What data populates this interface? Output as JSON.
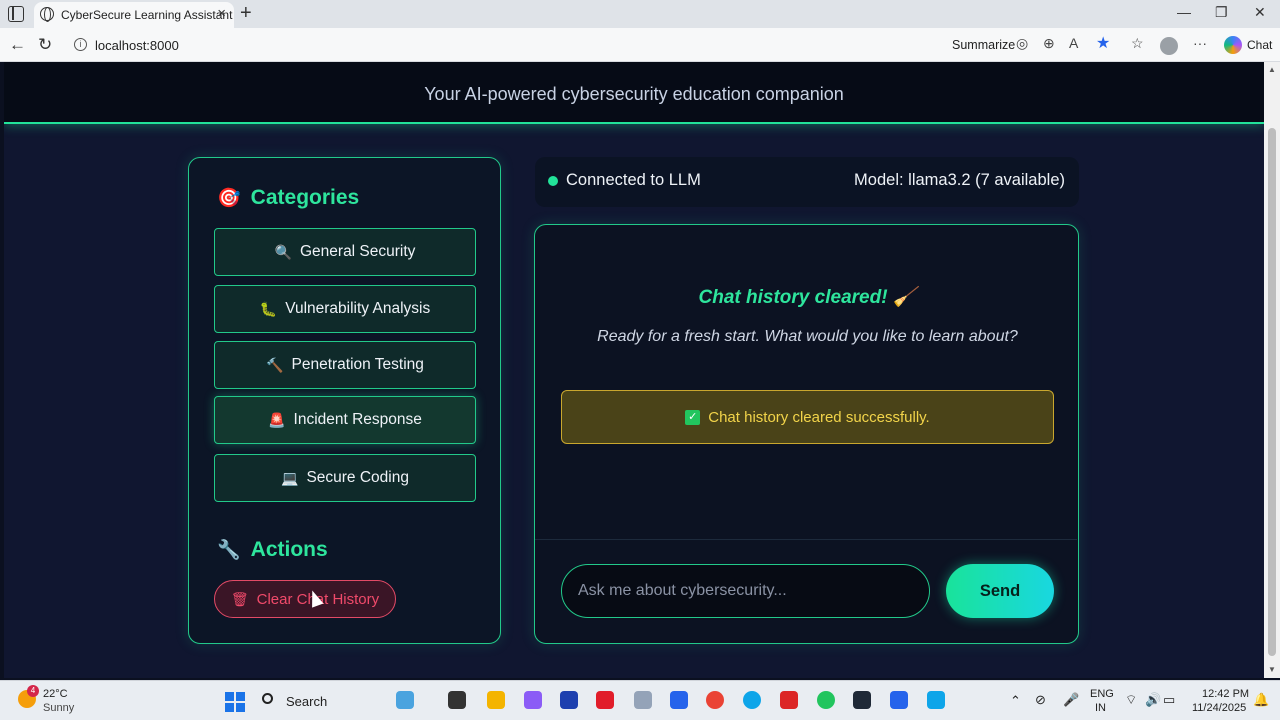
{
  "browser": {
    "tab_title": "CyberSecure Learning Assistant",
    "url": "localhost:8000",
    "summarize_label": "Summarize",
    "chat_label": "Chat"
  },
  "header": {
    "subtitle": "Your AI-powered cybersecurity education companion"
  },
  "sidebar": {
    "categories_title": "Categories",
    "categories_icon": "🎯",
    "categories": [
      {
        "icon": "🔍",
        "label": "General Security",
        "icon_name": "magnifier-icon"
      },
      {
        "icon": "🐛",
        "label": "Vulnerability Analysis",
        "icon_name": "bug-icon"
      },
      {
        "icon": "🔨",
        "label": "Penetration Testing",
        "icon_name": "hammer-icon"
      },
      {
        "icon": "🚨",
        "label": "Incident Response",
        "icon_name": "siren-icon"
      },
      {
        "icon": "💻",
        "label": "Secure Coding",
        "icon_name": "laptop-icon"
      }
    ],
    "actions_title": "Actions",
    "actions_icon": "🔧",
    "clear_icon": "🗑",
    "clear_label": "Clear Chat History"
  },
  "status": {
    "connection": "Connected to LLM",
    "model": "Model: llama3.2 (7 available)",
    "dot_color": "#22e39a"
  },
  "chat": {
    "heading": "Chat history cleared! 🧹",
    "subtext": "Ready for a fresh start. What would you like to learn about?",
    "success_message": "Chat history cleared successfully.",
    "input_placeholder": "Ask me about cybersecurity...",
    "send_label": "Send"
  },
  "taskbar": {
    "weather_temp": "22°C",
    "weather_desc": "Sunny",
    "weather_badge": "4",
    "search_label": "Search",
    "lang_primary": "ENG",
    "lang_secondary": "IN",
    "time": "12:42 PM",
    "date": "11/24/2025"
  },
  "colors": {
    "accent": "#22e39a",
    "danger": "#f04a6a",
    "warning": "#f2d44a",
    "background": "#101630"
  }
}
